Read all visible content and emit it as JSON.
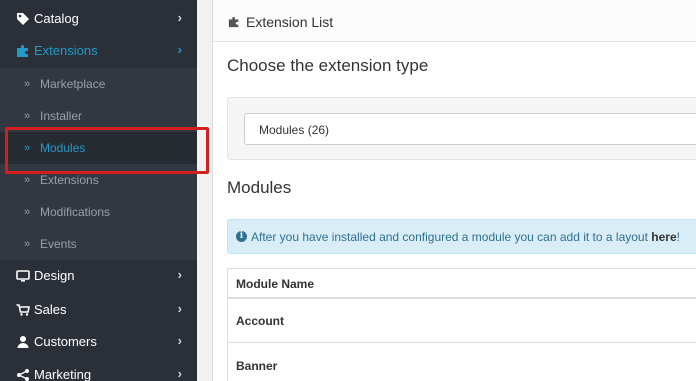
{
  "sidebar": {
    "catalog_label": "Catalog",
    "extensions_label": "Extensions",
    "sub_items": [
      "Marketplace",
      "Installer",
      "Modules",
      "Extensions",
      "Modifications",
      "Events"
    ],
    "design_label": "Design",
    "sales_label": "Sales",
    "customers_label": "Customers",
    "marketing_label": "Marketing"
  },
  "main": {
    "heading": "Extension List",
    "choose_title": "Choose the extension type",
    "type_select_value": "Modules (26)",
    "modules_title": "Modules",
    "alert_text": "After you have installed and configured a module you can add it to a layout",
    "alert_link": "here",
    "alert_suffix": "!",
    "table_header": "Module Name",
    "rows": [
      "Account",
      "Banner"
    ]
  },
  "colors": {
    "sidebar_bg": "#2b3038",
    "accent": "#229ac8",
    "highlight": "#d41f1f",
    "alert_bg": "#d9edf7"
  }
}
